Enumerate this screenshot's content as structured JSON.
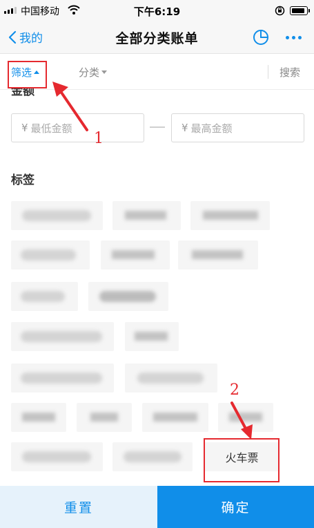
{
  "status_bar": {
    "carrier": "中国移动",
    "time": "下午6:19",
    "signal_icon": "signal-bars-icon",
    "wifi_icon": "wifi-icon",
    "orientation_lock_icon": "orientation-lock-icon",
    "battery_icon": "battery-icon"
  },
  "nav": {
    "back_label": "我的",
    "title": "全部分类账单",
    "pie_icon": "pie-chart-icon",
    "more_icon": "more-dots-icon"
  },
  "tabs": {
    "filter": "筛选",
    "category": "分类",
    "search": "搜索"
  },
  "filter": {
    "amount_title": "金额",
    "min_placeholder": "最低金额",
    "max_placeholder": "最高金额",
    "currency_symbol": "¥",
    "tags_title": "标签",
    "visible_tag": "火车票"
  },
  "annotations": {
    "marker_1": "1",
    "marker_2": "2",
    "color": "#e5292f"
  },
  "bottom": {
    "reset": "重置",
    "confirm": "确定"
  },
  "colors": {
    "accent": "#108ee9",
    "tag_bg": "#f5f5f5"
  }
}
